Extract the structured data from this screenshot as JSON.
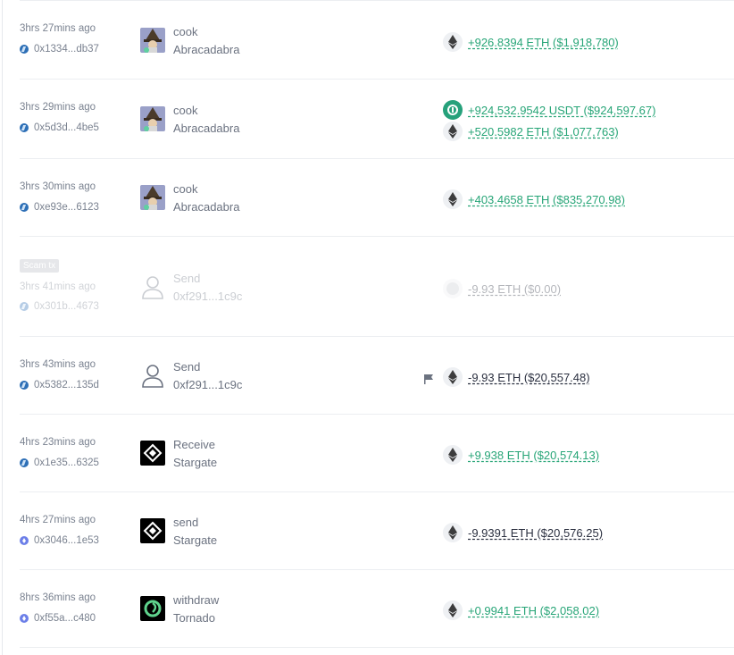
{
  "colors": {
    "positive": "#27a577",
    "negative": "#2b3040",
    "muted": "#7a8290",
    "usdt": "#26a17b"
  },
  "transactions": [
    {
      "time": "3hrs 27mins ago",
      "hash": "0x1334...db37",
      "chain": "arbitrum-icon",
      "action": "cook",
      "protocol": "Abracadabra",
      "protocol_icon": "abracadabra-wizard-icon",
      "transfers": [
        {
          "token": "eth-icon",
          "amount": "+926.8394 ETH ($1,918,780)",
          "direction": "in"
        }
      ]
    },
    {
      "time": "3hrs 29mins ago",
      "hash": "0x5d3d...4be5",
      "chain": "arbitrum-icon",
      "action": "cook",
      "protocol": "Abracadabra",
      "protocol_icon": "abracadabra-wizard-icon",
      "transfers": [
        {
          "token": "usdt-icon",
          "amount": "+924,532.9542 USDT ($924,597.67)",
          "direction": "in"
        },
        {
          "token": "eth-icon",
          "amount": "+520.5982 ETH ($1,077,763)",
          "direction": "in"
        }
      ]
    },
    {
      "time": "3hrs 30mins ago",
      "hash": "0xe93e...6123",
      "chain": "arbitrum-icon",
      "action": "cook",
      "protocol": "Abracadabra",
      "protocol_icon": "abracadabra-wizard-icon",
      "transfers": [
        {
          "token": "eth-icon",
          "amount": "+403.4658 ETH ($835,270.98)",
          "direction": "in"
        }
      ]
    },
    {
      "badge": "Scam tx",
      "time": "3hrs 41mins ago",
      "hash": "0x301b...4673",
      "chain": "arbitrum-icon",
      "action": "Send",
      "protocol": "0xf291...1c9c",
      "protocol_icon": "user-icon",
      "transfers": [
        {
          "token": "unknown-token-icon",
          "amount": "-9.93 ETH ($0.00)",
          "direction": "out"
        }
      ]
    },
    {
      "time": "3hrs 43mins ago",
      "hash": "0x5382...135d",
      "chain": "arbitrum-icon",
      "action": "Send",
      "protocol": "0xf291...1c9c",
      "protocol_icon": "user-icon",
      "flag": "flag-icon",
      "transfers": [
        {
          "token": "eth-icon",
          "amount": "-9.93 ETH ($20,557.48)",
          "direction": "out"
        }
      ]
    },
    {
      "time": "4hrs 23mins ago",
      "hash": "0x1e35...6325",
      "chain": "arbitrum-icon",
      "action": "Receive",
      "protocol": "Stargate",
      "protocol_icon": "stargate-icon",
      "transfers": [
        {
          "token": "eth-icon",
          "amount": "+9.938 ETH ($20,574.13)",
          "direction": "in"
        }
      ]
    },
    {
      "time": "4hrs 27mins ago",
      "hash": "0x3046...1e53",
      "chain": "ethereum-icon",
      "action": "send",
      "protocol": "Stargate",
      "protocol_icon": "stargate-icon",
      "transfers": [
        {
          "token": "eth-icon",
          "amount": "-9.9391 ETH ($20,576.25)",
          "direction": "out"
        }
      ]
    },
    {
      "time": "8hrs 36mins ago",
      "hash": "0xf55a...c480",
      "chain": "ethereum-icon",
      "action": "withdraw",
      "protocol": "Tornado",
      "protocol_icon": "tornado-icon",
      "transfers": [
        {
          "token": "eth-icon",
          "amount": "+0.9941 ETH ($2,058.02)",
          "direction": "in"
        }
      ]
    }
  ]
}
